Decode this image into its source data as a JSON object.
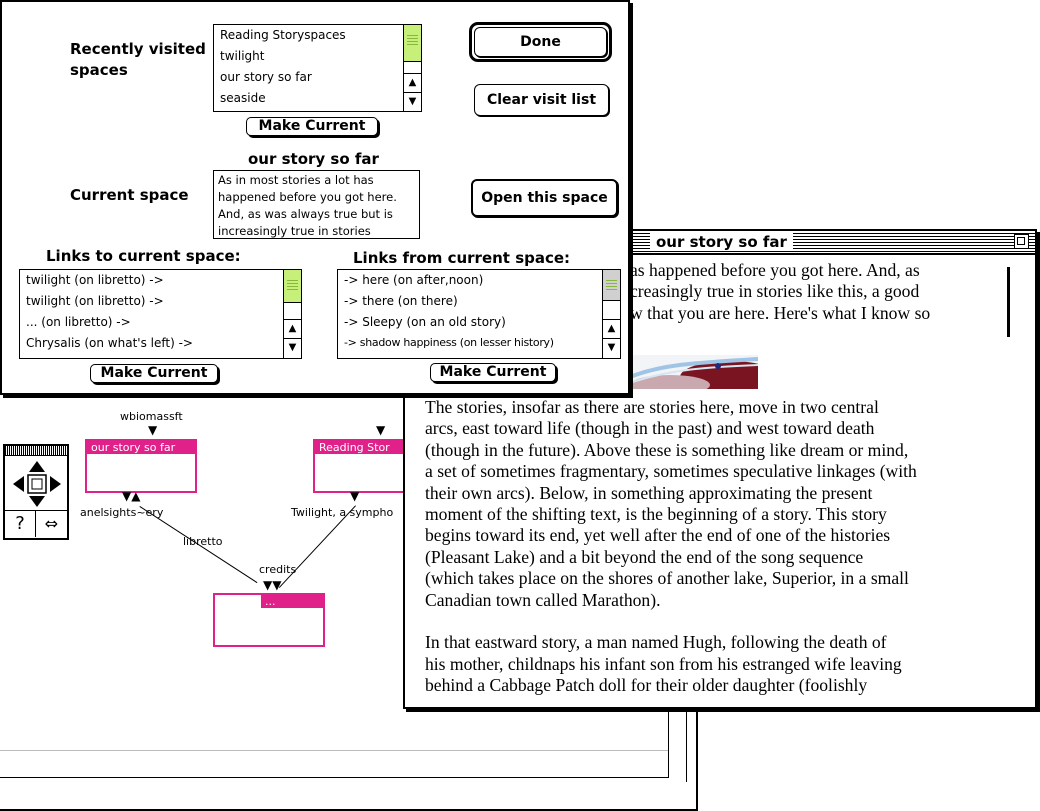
{
  "dialog": {
    "recent_label_line1": "Recently visited",
    "recent_label_line2": "spaces",
    "recent_items": [
      "Reading Storyspaces",
      "twilight",
      "our story so far",
      "seaside"
    ],
    "make_current": "Make Current",
    "done": "Done",
    "clear_visit_list": "Clear visit list",
    "current_space_label": "Current space",
    "current_space_name": "our story so far",
    "current_preview": [
      "As in most stories a lot has",
      "happened  before you got here.",
      "And, as was always true but is",
      "increasingly true in stories"
    ],
    "open_this_space": "Open this space",
    "links_to_label": "Links to current space:",
    "links_to_items": [
      "twilight (on libretto) ->",
      "twilight (on libretto) ->",
      "... (on libretto) ->",
      "Chrysalis (on what's left) ->"
    ],
    "links_from_label": "Links from current space:",
    "links_from_items": [
      "-> here (on after,noon)",
      "-> there (on there)",
      "-> Sleepy (on an old story)",
      "-> shadow happiness (on lesser history)"
    ]
  },
  "map": {
    "nodes": {
      "our_story": "our story so far",
      "reading": "Reading Stor",
      "ellipsis": "..."
    },
    "labels": {
      "wbiomassft": "wbiomassft",
      "anelsights": "anelsights~ery",
      "libretto": "libretto",
      "credits": "credits",
      "twilight": "Twilight, a sympho"
    }
  },
  "text_window": {
    "title": "our story so far",
    "top_lines": [
      "as happened  before you got here. And, as",
      "creasingly true in stories like this, a good",
      "w that you are here. Here's what I know so"
    ],
    "paragraph1": [
      "The stories, insofar as there are stories here, move in two central",
      "arcs, east toward life (though in the past) and west toward death",
      "(though in the future). Above these is something like dream or mind,",
      "a set of sometimes fragmentary, sometimes speculative linkages (with",
      "their own arcs). Below, in something approximating the present",
      "moment of the shifting text, is the beginning of a story. This story",
      "begins toward its end, yet well after the end of one of the histories",
      "(Pleasant Lake) and a bit beyond the end of the song sequence",
      "(which takes place on the shores of another lake, Superior, in a small",
      "Canadian town called Marathon)."
    ],
    "paragraph2": [
      "In that eastward story, a man named Hugh, following the death of",
      "his mother, childnaps his infant son from his estranged wife leaving",
      "behind a Cabbage Patch doll for their older daughter (foolishly"
    ]
  },
  "colors": {
    "node_pink": "#e0218a",
    "scroll_thumb": "#c7f07a"
  }
}
